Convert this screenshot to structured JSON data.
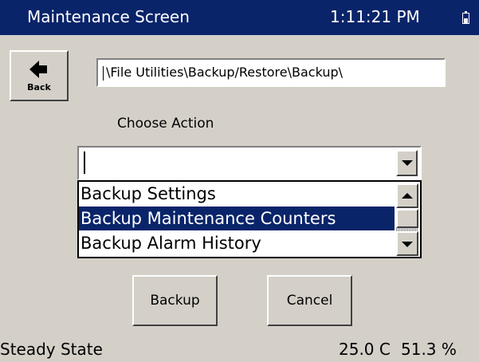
{
  "window": {
    "title": "Maintenance Screen",
    "time": "1:11:21 PM",
    "battery_icon": "battery-icon"
  },
  "toolbar": {
    "back_label": "Back",
    "back_icon": "arrow-left-icon"
  },
  "path": {
    "value": "\\File Utilities\\Backup/Restore\\Backup\\"
  },
  "action": {
    "label": "Choose Action",
    "combo_value": "",
    "options": [
      "Backup Settings",
      "Backup Maintenance Counters",
      "Backup Alarm History"
    ],
    "selected_index": 1
  },
  "buttons": {
    "backup": "Backup",
    "cancel": "Cancel"
  },
  "status": {
    "state": "Steady State",
    "temperature": "25.0 C",
    "humidity": "51.3 %"
  },
  "colors": {
    "titlebar": "#0a246a",
    "selection": "#0a246a",
    "background": "#d4d0c8"
  }
}
